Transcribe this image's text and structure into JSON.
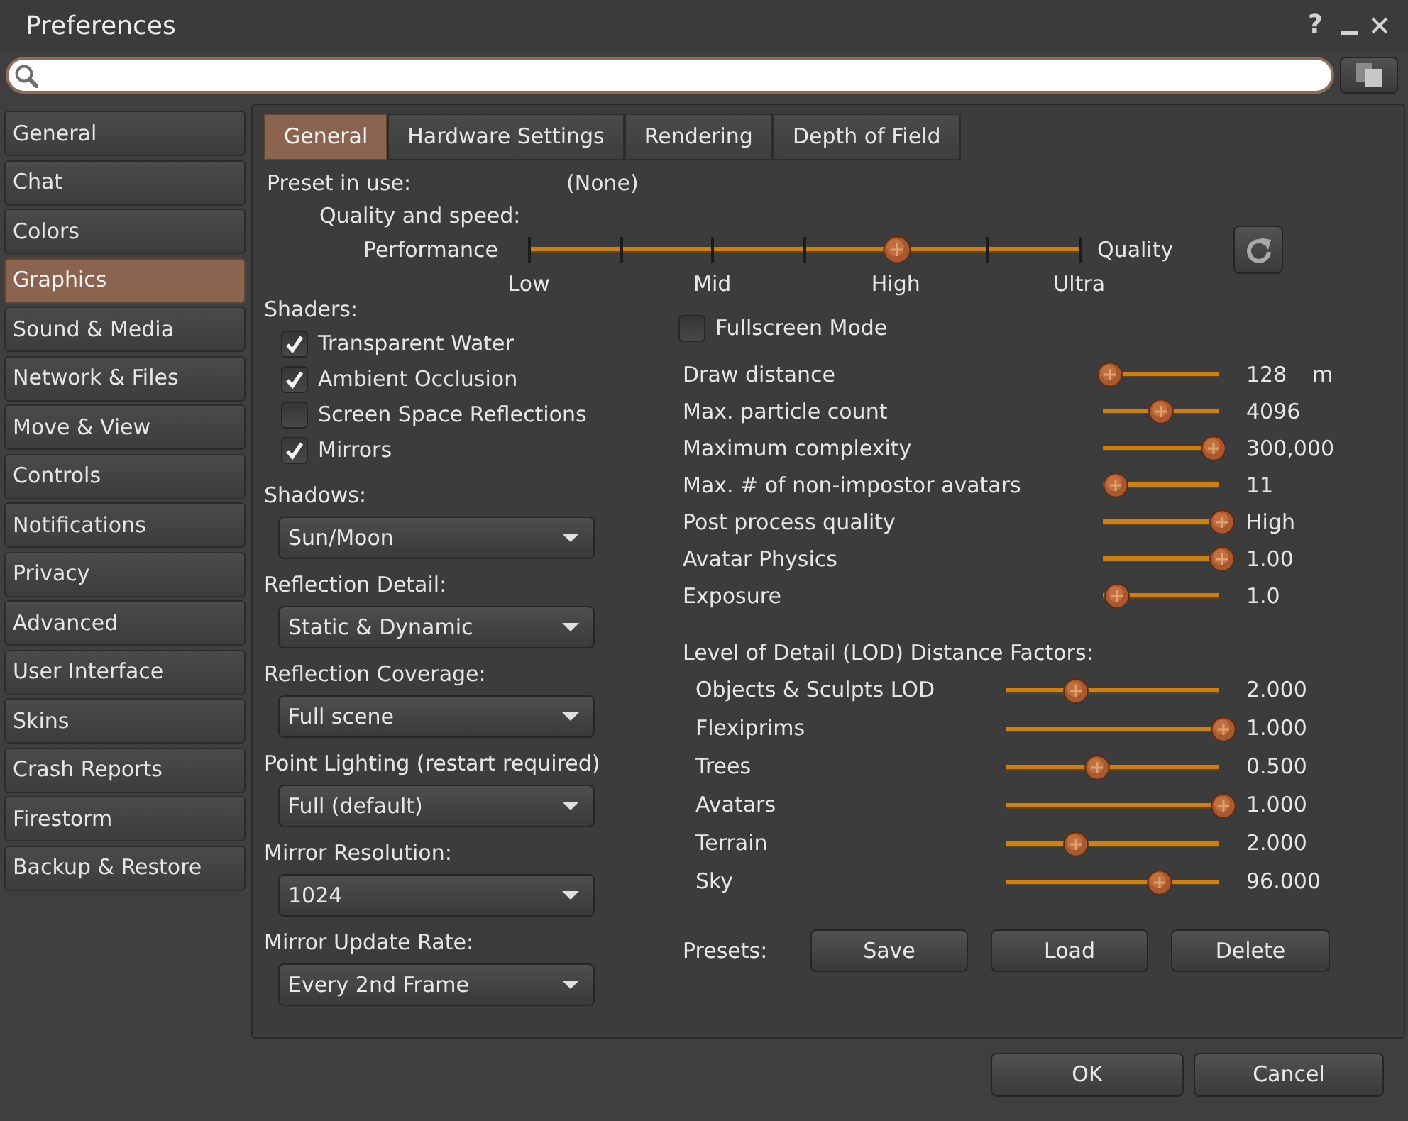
{
  "window": {
    "title": "Preferences",
    "help": "?"
  },
  "sidebar": {
    "items": [
      {
        "label": "General",
        "selected": false
      },
      {
        "label": "Chat",
        "selected": false
      },
      {
        "label": "Colors",
        "selected": false
      },
      {
        "label": "Graphics",
        "selected": true
      },
      {
        "label": "Sound & Media",
        "selected": false
      },
      {
        "label": "Network & Files",
        "selected": false
      },
      {
        "label": "Move & View",
        "selected": false
      },
      {
        "label": "Controls",
        "selected": false
      },
      {
        "label": "Notifications",
        "selected": false
      },
      {
        "label": "Privacy",
        "selected": false
      },
      {
        "label": "Advanced",
        "selected": false
      },
      {
        "label": "User Interface",
        "selected": false
      },
      {
        "label": "Skins",
        "selected": false
      },
      {
        "label": "Crash Reports",
        "selected": false
      },
      {
        "label": "Firestorm",
        "selected": false
      },
      {
        "label": "Backup & Restore",
        "selected": false
      }
    ]
  },
  "tabs": [
    {
      "label": "General",
      "selected": true
    },
    {
      "label": "Hardware Settings",
      "selected": false
    },
    {
      "label": "Rendering",
      "selected": false
    },
    {
      "label": "Depth of Field",
      "selected": false
    }
  ],
  "preset": {
    "label": "Preset in use:",
    "value": "(None)"
  },
  "quality": {
    "label": "Quality and speed:",
    "low_end": "Performance",
    "high_end": "Quality",
    "level": 0.667,
    "tick_labels": [
      "Low",
      "Mid",
      "High",
      "Ultra"
    ]
  },
  "shaders": {
    "label": "Shaders:",
    "options": [
      {
        "label": "Transparent Water",
        "checked": true
      },
      {
        "label": "Ambient Occlusion",
        "checked": true
      },
      {
        "label": "Screen Space Reflections",
        "checked": false
      },
      {
        "label": "Mirrors",
        "checked": true
      }
    ]
  },
  "dropdowns": [
    {
      "label": "Shadows:",
      "value": "Sun/Moon"
    },
    {
      "label": "Reflection Detail:",
      "value": "Static & Dynamic"
    },
    {
      "label": "Reflection Coverage:",
      "value": "Full scene"
    },
    {
      "label": "Point Lighting (restart required)",
      "value": "Full (default)"
    },
    {
      "label": "Mirror Resolution:",
      "value": "1024"
    },
    {
      "label": "Mirror Update Rate:",
      "value": "Every 2nd Frame"
    }
  ],
  "fullscreen": {
    "label": "Fullscreen Mode",
    "checked": false
  },
  "sliders": [
    {
      "label": "Draw distance",
      "level": 0,
      "value": "128",
      "unit": "m"
    },
    {
      "label": "Max. particle count",
      "level": 0.46,
      "value": "4096"
    },
    {
      "label": "Maximum complexity",
      "level": 0.92,
      "value": "300,000"
    },
    {
      "label": "Max. # of non-impostor avatars",
      "level": 0.05,
      "value": "11"
    },
    {
      "label": "Post process quality",
      "level": 1,
      "value": "High"
    },
    {
      "label": "Avatar Physics",
      "level": 1,
      "value": "1.00"
    },
    {
      "label": "Exposure",
      "level": 0.06,
      "value": "1.0"
    }
  ],
  "lod": {
    "label": "Level of Detail (LOD) Distance Factors:",
    "sliders": [
      {
        "label": "Objects & Sculpts LOD",
        "level": 0.3,
        "value": "2.000"
      },
      {
        "label": "Flexiprims",
        "level": 1,
        "value": "1.000"
      },
      {
        "label": "Trees",
        "level": 0.4,
        "value": "0.500"
      },
      {
        "label": "Avatars",
        "level": 1,
        "value": "1.000"
      },
      {
        "label": "Terrain",
        "level": 0.3,
        "value": "2.000"
      },
      {
        "label": "Sky",
        "level": 0.7,
        "value": "96.000"
      }
    ]
  },
  "presets": {
    "label": "Presets:",
    "buttons": [
      "Save",
      "Load",
      "Delete"
    ]
  },
  "dialog_buttons": [
    "OK",
    "Cancel"
  ]
}
